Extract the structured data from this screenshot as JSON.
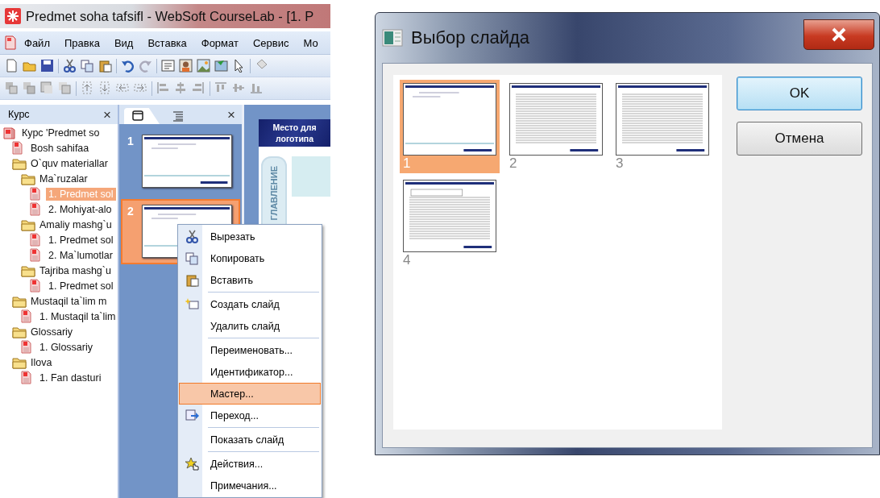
{
  "app": {
    "title": "Predmet soha tafsifl - WebSoft CourseLab - [1. P",
    "menu": [
      "Файл",
      "Правка",
      "Вид",
      "Вставка",
      "Формат",
      "Сервис",
      "Мо"
    ],
    "course_panel": {
      "title": "Курс",
      "close": "×",
      "tree": [
        {
          "label": "Курс 'Predmet so",
          "kind": "course",
          "selected": false,
          "children": [
            {
              "label": "Bosh sahifaa",
              "kind": "page",
              "selected": false
            },
            {
              "label": "O`quv materiallar",
              "kind": "folder",
              "selected": false,
              "children": [
                {
                  "label": "Ma`ruzalar",
                  "kind": "folder",
                  "selected": false,
                  "children": [
                    {
                      "label": "1. Predmet sol",
                      "kind": "page",
                      "selected": true
                    },
                    {
                      "label": "2. Mohiyat-alo",
                      "kind": "page",
                      "selected": false
                    }
                  ]
                },
                {
                  "label": "Amaliy mashg`u",
                  "kind": "folder",
                  "selected": false,
                  "children": [
                    {
                      "label": "1. Predmet sol",
                      "kind": "page",
                      "selected": false
                    },
                    {
                      "label": "2. Ma`lumotlar",
                      "kind": "page",
                      "selected": false
                    }
                  ]
                },
                {
                  "label": "Tajriba mashg`u",
                  "kind": "folder",
                  "selected": false,
                  "children": [
                    {
                      "label": "1. Predmet sol",
                      "kind": "page",
                      "selected": false
                    }
                  ]
                }
              ]
            },
            {
              "label": "Mustaqil ta`lim m",
              "kind": "folder",
              "selected": false,
              "children": [
                {
                  "label": "1. Mustaqil ta`lim",
                  "kind": "page",
                  "selected": false
                }
              ]
            },
            {
              "label": "Glossariy",
              "kind": "folder",
              "selected": false,
              "children": [
                {
                  "label": "1. Glossariy",
                  "kind": "page",
                  "selected": false
                }
              ]
            },
            {
              "label": "Ilova",
              "kind": "folder",
              "selected": false,
              "children": [
                {
                  "label": "1. Fan dasturi",
                  "kind": "page",
                  "selected": false
                }
              ]
            }
          ]
        }
      ]
    },
    "slides_panel": {
      "close": "×",
      "tabs": [
        {
          "selected": true
        },
        {
          "selected": false
        }
      ],
      "slides": [
        {
          "number": "1",
          "selected": false
        },
        {
          "number": "2",
          "selected": true
        }
      ]
    },
    "editor": {
      "logo_lines": [
        "Место для",
        "логотипа"
      ],
      "side_tab": "ГЛАВЛЕНИЕ"
    },
    "context_menu": [
      {
        "label": "Вырезать",
        "selected": false,
        "separator_after": false
      },
      {
        "label": "Копировать",
        "selected": false,
        "separator_after": false
      },
      {
        "label": "Вставить",
        "selected": false,
        "separator_after": true
      },
      {
        "label": "Создать слайд",
        "selected": false,
        "separator_after": false
      },
      {
        "label": "Удалить слайд",
        "selected": false,
        "separator_after": true
      },
      {
        "label": "Переименовать...",
        "selected": false,
        "separator_after": false
      },
      {
        "label": "Идентификатор...",
        "selected": false,
        "separator_after": false
      },
      {
        "label": "Мастер...",
        "selected": true,
        "separator_after": false
      },
      {
        "label": "Переход...",
        "selected": false,
        "separator_after": true
      },
      {
        "label": "Показать слайд",
        "selected": false,
        "separator_after": true
      },
      {
        "label": "Действия...",
        "selected": false,
        "separator_after": false
      },
      {
        "label": "Примечания...",
        "selected": false,
        "separator_after": false
      }
    ]
  },
  "dialog": {
    "title": "Выбор слайда",
    "slides": [
      {
        "number": "1",
        "selected": true,
        "kind": "title"
      },
      {
        "number": "2",
        "selected": false,
        "kind": "text"
      },
      {
        "number": "3",
        "selected": false,
        "kind": "text"
      },
      {
        "number": "4",
        "selected": false,
        "kind": "table"
      }
    ],
    "buttons": [
      {
        "label": "OK",
        "default": true
      },
      {
        "label": "Отмена",
        "default": false
      }
    ]
  }
}
